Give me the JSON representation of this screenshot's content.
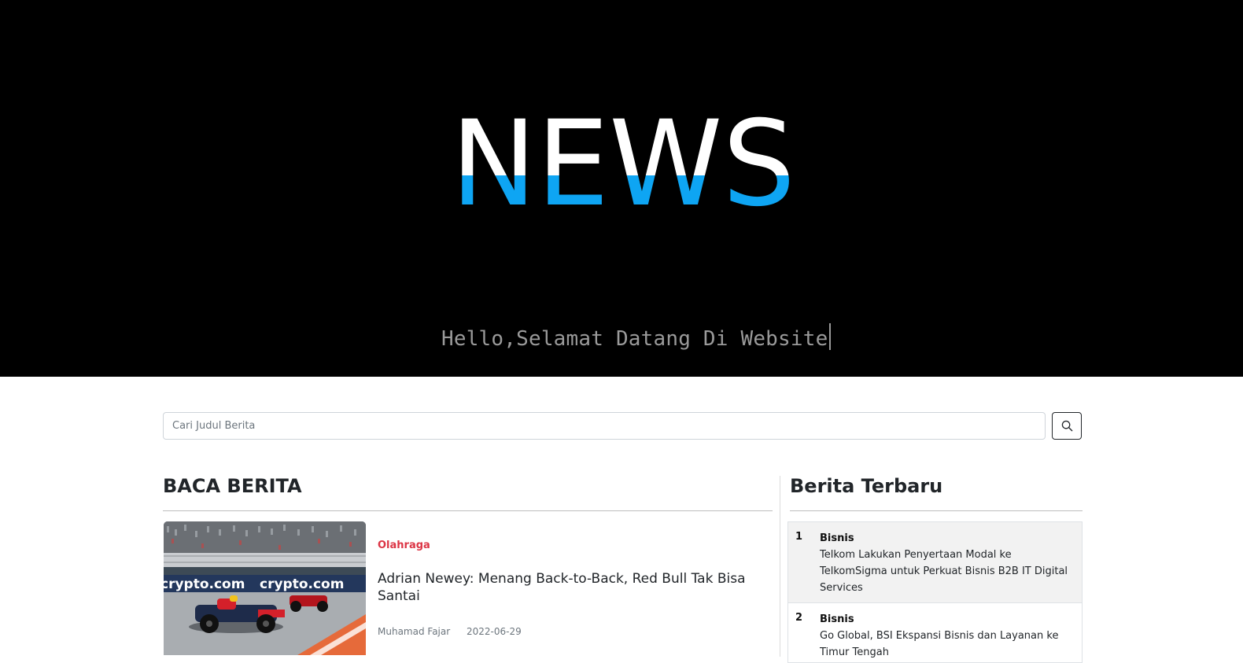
{
  "hero": {
    "logo": "NEWS",
    "welcome": "Hello,Selamat Datang Di Website",
    "colors": {
      "background": "#000000",
      "logo_top": "#ffffff",
      "logo_bottom": "#0ea5f3",
      "welcome_text": "#9a9a9a"
    }
  },
  "search": {
    "placeholder": "Cari Judul Berita",
    "icon": "search-icon"
  },
  "main": {
    "heading": "BACA BERITA",
    "articles": [
      {
        "category": "Olahraga",
        "title": "Adrian Newey: Menang Back-to-Back, Red Bull Tak Bisa Santai",
        "author": "Muhamad Fajar",
        "date": "2022-06-29",
        "image_banner_text": "crypto.com"
      }
    ]
  },
  "sidebar": {
    "heading": "Berita Terbaru",
    "items": [
      {
        "number": "1",
        "category": "Bisnis",
        "title": "Telkom Lakukan Penyertaan Modal ke TelkomSigma untuk Perkuat Bisnis B2B IT Digital Services"
      },
      {
        "number": "2",
        "category": "Bisnis",
        "title": "Go Global, BSI Ekspansi Bisnis dan Layanan ke Timur Tengah"
      }
    ]
  },
  "colors": {
    "category_accent": "#dc3545",
    "text": "#212529",
    "muted": "#6c757d"
  }
}
